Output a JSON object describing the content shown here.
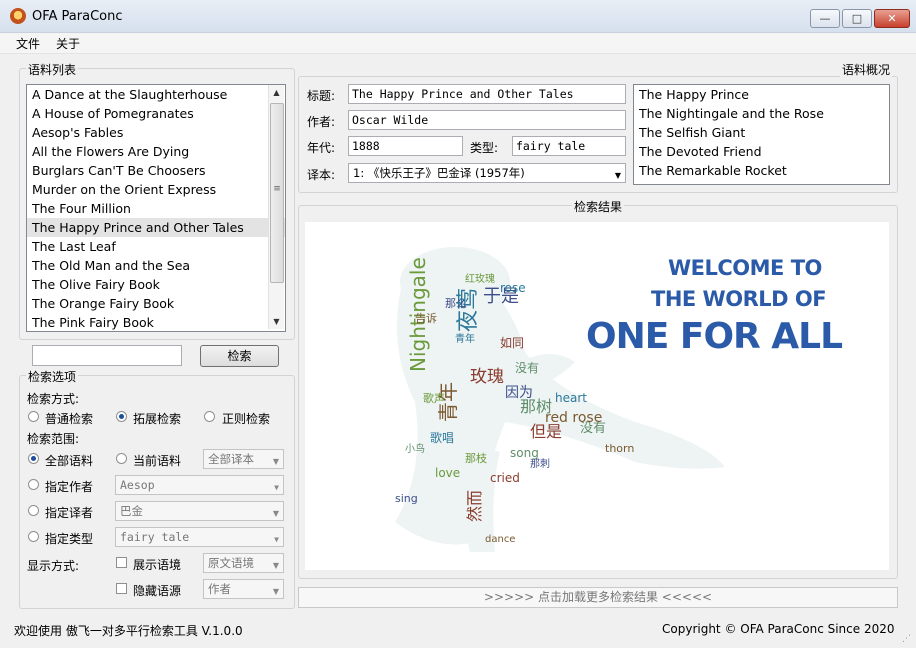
{
  "window": {
    "title": "OFA ParaConc",
    "minimize": "—",
    "maximize": "□",
    "close": "✕"
  },
  "menu": [
    "文件",
    "关于"
  ],
  "corpus": {
    "title": "语料列表",
    "items": [
      "A Dance at the Slaughterhouse",
      "A House of Pomegranates",
      "Aesop's Fables",
      "All the Flowers Are Dying",
      "Burglars Can'T Be Choosers",
      "Murder on the Orient Express",
      "The Four Million",
      "The Happy Prince and Other Tales",
      "The Last Leaf",
      "The Old Man and the Sea",
      "The Olive Fairy Book",
      "The Orange Fairy Book",
      "The Pink Fairy Book"
    ],
    "selected_index": 7,
    "scroll_up": "▲",
    "scroll_down": "▼",
    "scroll_grip": "≡"
  },
  "search": {
    "input_value": "",
    "button": "检索"
  },
  "options": {
    "title": "检索选项",
    "mode_label": "检索方式:",
    "modes": [
      "普通检索",
      "拓展检索",
      "正则检索"
    ],
    "mode_selected": 1,
    "scope_label": "检索范围:",
    "scope_all": "全部语料",
    "scope_current": "当前语料",
    "scope_selected": "全部语料",
    "translation_combo": "全部译本",
    "author_label": "指定作者",
    "author_combo": "Aesop",
    "translator_label": "指定译者",
    "translator_combo": "巴金",
    "type_label": "指定类型",
    "type_combo": "fairy tale",
    "display_label": "显示方式:",
    "show_context": "展示语境",
    "context_combo": "原文语境",
    "hide_source": "隐藏语源",
    "source_combo": "作者"
  },
  "details": {
    "title_label": "标题:",
    "title_value": "The Happy Prince and Other Tales",
    "author_label": "作者:",
    "author_value": "Oscar Wilde",
    "year_label": "年代:",
    "year_value": "1888",
    "type_label": "类型:",
    "type_value": "fairy tale",
    "translation_label": "译本:",
    "translation_value": "1: 《快乐王子》巴金译 (1957年)"
  },
  "overview": {
    "title": "语料概况",
    "items": [
      "The Happy Prince",
      "The Nightingale and the Rose",
      "The Selfish Giant",
      "The Devoted Friend",
      "The Remarkable Rocket"
    ]
  },
  "results": {
    "title": "检索结果",
    "welcome_line1": "WELCOME TO",
    "welcome_line2": "THE WORLD OF",
    "welcome_line3": "ONE FOR ALL",
    "wordcloud_words": [
      "夜莺",
      "Nightingale",
      "玫瑰",
      "于是",
      "那树",
      "青年",
      "rose",
      "红玫瑰",
      "但是",
      "因为",
      "没有",
      "告诉",
      "歌唱",
      "那枝",
      "然而",
      "那么",
      "没有",
      "thorn",
      "heart",
      "love",
      "cried",
      "sing",
      "song",
      "red rose",
      "青年",
      "歌声",
      "如同",
      "那刺",
      "小鸟",
      "dance"
    ],
    "load_more": ">>>>> 点击加载更多检索结果 <<<<<"
  },
  "status": {
    "left": "欢迎使用 傲飞一对多平行检索工具 V.1.0.0",
    "right": "Copyright © OFA ParaConc Since 2020"
  },
  "colors": {
    "welcome_blue": "#2a5aa8",
    "cloud_colors": [
      "#2b7a9b",
      "#6a9a3a",
      "#8a3d2e",
      "#3d4e8a",
      "#5f8f6a",
      "#7a5a2e"
    ]
  }
}
